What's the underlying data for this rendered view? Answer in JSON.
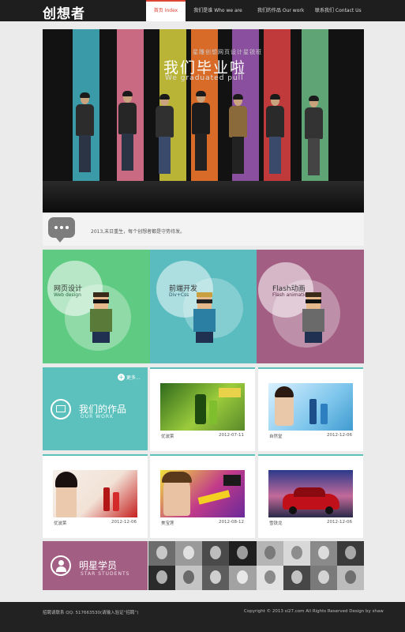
{
  "header": {
    "logo": "创想者",
    "nav": [
      "首页 Index",
      "我们是谁 Who we are",
      "我们的作品 Our work",
      "联系我们 Contact Us"
    ]
  },
  "banner": {
    "subtitle": "星雕创想网页设计星锐班",
    "title": "我们毕业啦",
    "title_en": "We graduated pull",
    "stripe_colors": [
      "#3b9aa8",
      "#c96a82",
      "#b9b436",
      "#d86b27",
      "#8b4fa0",
      "#c0393b",
      "#5ea474"
    ]
  },
  "slogan": {
    "text": "2013,末日重生，每个创想者都是守势待发。"
  },
  "services": [
    {
      "title": "网页设计",
      "subtitle": "Web design",
      "color": "#5fcb82"
    },
    {
      "title": "前端开发",
      "subtitle": "Div+Css",
      "color": "#5bbcc0"
    },
    {
      "title": "Flash动画",
      "subtitle": "Flash animation",
      "color": "#a35f83"
    }
  ],
  "works": {
    "title": "我们的作品",
    "subtitle": "OUR WORK",
    "more": "更多...",
    "items": [
      {
        "caption": "优波莱",
        "date": "2012-07-11"
      },
      {
        "caption": "自然堂",
        "date": "2012-12-06"
      },
      {
        "caption": "优波莱",
        "date": "2012-12-06"
      },
      {
        "caption": "美宝莲",
        "date": "2012-08-12"
      },
      {
        "caption": "雪铁龙",
        "date": "2012-12-06"
      }
    ]
  },
  "students": {
    "title": "明星学员",
    "subtitle": "STAR STUDENTS"
  },
  "footer": {
    "left": "招聘请联系 QQ: 517663530(请输入验证“招聘”)",
    "right": "Copyright © 2013 si27.com  All Rights Reserved    Design by shaw"
  }
}
